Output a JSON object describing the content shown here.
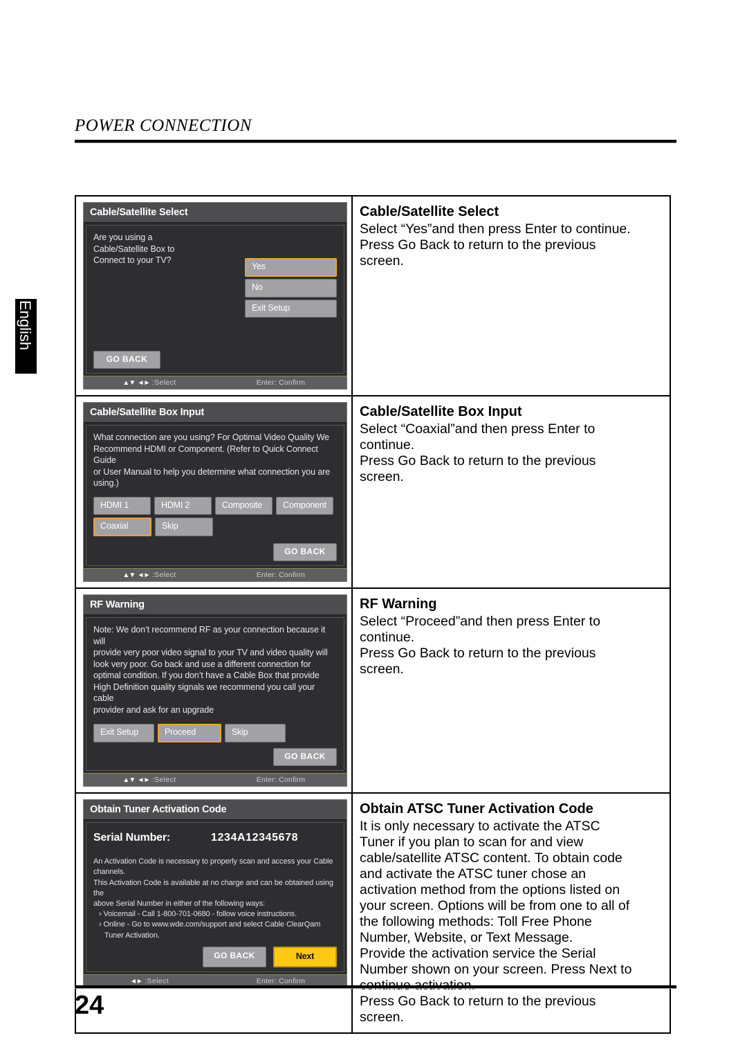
{
  "header": {
    "title": "POWER CONNECTION"
  },
  "language_tab": {
    "label": "English"
  },
  "footer": {
    "page_number": "24"
  },
  "osd_footer": {
    "arrows_vertical": "▲▼",
    "arrows_horizontal": "◄►",
    "select_label": ":Select",
    "confirm_label": "Enter: Confirm"
  },
  "rows": [
    {
      "panel": {
        "title": "Cable/Satellite Select",
        "prompt": "Are you using a\nCable/Satellite Box to\nConnect to your TV?",
        "options": [
          "Yes",
          "No",
          "Exit Setup"
        ],
        "selected_option": "Yes",
        "go_back_label": "GO BACK"
      },
      "description": {
        "title": "Cable/Satellite Select",
        "body": "Select “Yes”and then press Enter to continue.\nPress Go Back to return to the previous\nscreen."
      }
    },
    {
      "panel": {
        "title": "Cable/Satellite Box Input",
        "prompt": "What connection are you using? For Optimal Video Quality We\nRecommend HDMI or Component. (Refer to Quick Connect Guide\nor User Manual to help you determine what connection you are\nusing.)",
        "options_row1": [
          "HDMI 1",
          "HDMI 2",
          "Composite",
          "Component"
        ],
        "options_row2": [
          "Coaxial",
          "Skip"
        ],
        "selected_option": "Coaxial",
        "go_back_label": "GO BACK"
      },
      "description": {
        "title": "Cable/Satellite Box Input",
        "body": "Select “Coaxial”and then press Enter to\ncontinue.\nPress Go Back to return to the previous\nscreen."
      }
    },
    {
      "panel": {
        "title": "RF Warning",
        "prompt": "Note: We don’t recommend RF as your connection because it will\nprovide very poor video signal to your TV and video quality will\nlook very poor. Go back and use a different connection for\noptimal condition. If you don’t have a Cable Box that provide\nHigh Definition quality signals we recommend you call your cable\nprovider and ask for an upgrade",
        "options": [
          "Exit Setup",
          "Proceed",
          "Skip"
        ],
        "selected_option": "Proceed",
        "go_back_label": "GO BACK"
      },
      "description": {
        "title": "RF Warning",
        "body": "Select “Proceed”and then press Enter to\ncontinue.\nPress Go Back to return to the previous\nscreen."
      }
    },
    {
      "panel": {
        "title": "Obtain Tuner Activation Code",
        "serial_label": "Serial Number:",
        "serial_value": "1234A12345678",
        "body_1": "An Activation Code is necessary to properly scan and access your Cable\nchannels.\nThis Activation Code is available at no charge and can be obtained using the\nabove Serial Number in either of the following ways:",
        "bullet_1": "› Voicemail - Call 1-800-701-0680 - follow voice instructions.",
        "bullet_2": "› Online - Go to www.wde.com/support and select Cable ClearQam Tuner\n   Activation.",
        "go_back_label": "GO BACK",
        "next_label": "Next"
      },
      "description": {
        "title": "Obtain ATSC Tuner Activation Code",
        "body": "It is only necessary to activate the ATSC\nTuner if you plan to scan for and view\ncable/satellite ATSC content. To obtain code\nand activate the ATSC tuner chose an\nactivation method from the options listed on\nyour screen. Options will be from one to all of\nthe following methods: Toll Free Phone\nNumber, Website, or Text Message.\nProvide the activation service the Serial\nNumber shown on your screen. Press Next to\ncontinue activation.\nPress Go Back to return to the previous\nscreen."
      }
    }
  ],
  "colors": {
    "highlight_border": "#e8a53a",
    "next_button": "#ffc913",
    "panel_bg": "#2b2b2d",
    "button_bg": "#a2a2a4"
  }
}
